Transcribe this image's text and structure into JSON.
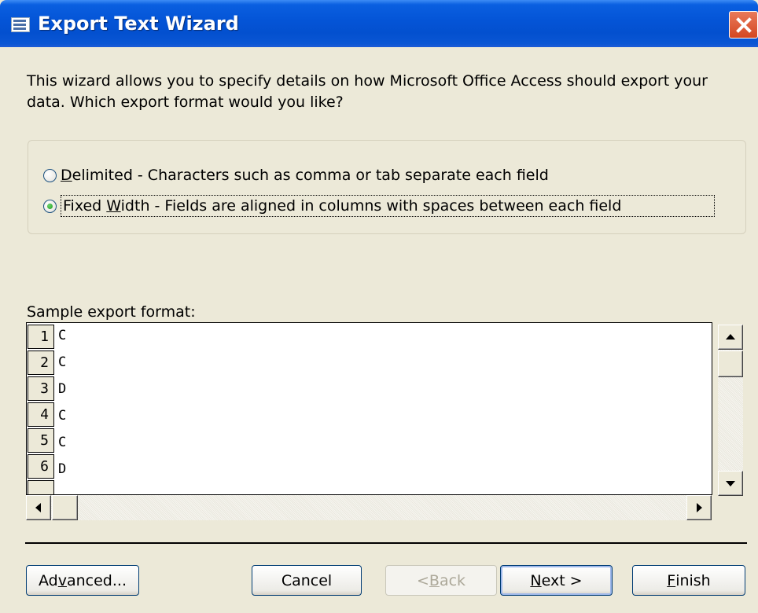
{
  "window": {
    "title": "Export Text Wizard"
  },
  "intro_text": "This wizard allows you to specify details on how Microsoft Office Access should export your data. Which export format would you like?",
  "format_options": [
    {
      "label_prefix": "",
      "accel": "D",
      "label_rest": "elimited - Characters such as comma or tab separate each field",
      "checked": false
    },
    {
      "label_prefix": "Fixed ",
      "accel": "W",
      "label_rest": "idth - Fields are aligned in columns with spaces between each field",
      "checked": true
    }
  ],
  "sample": {
    "label": "Sample export format:",
    "rows": [
      {
        "num": "1",
        "value": "C"
      },
      {
        "num": "2",
        "value": "C"
      },
      {
        "num": "3",
        "value": "D"
      },
      {
        "num": "4",
        "value": "C"
      },
      {
        "num": "5",
        "value": "C"
      },
      {
        "num": "6",
        "value": "D"
      }
    ]
  },
  "buttons": {
    "advanced": {
      "prefix": "Ad",
      "accel": "v",
      "suffix": "anced..."
    },
    "cancel": "Cancel",
    "back": {
      "prefix": "< ",
      "accel": "B",
      "suffix": "ack",
      "enabled": false
    },
    "next": {
      "prefix": "",
      "accel": "N",
      "suffix": "ext >"
    },
    "finish": {
      "prefix": "",
      "accel": "F",
      "suffix": "inish"
    }
  },
  "colors": {
    "titlebar": "#0454d6",
    "dialog_bg": "#ece9d8",
    "close_button": "#d44721",
    "radio_checked": "#21a121"
  }
}
